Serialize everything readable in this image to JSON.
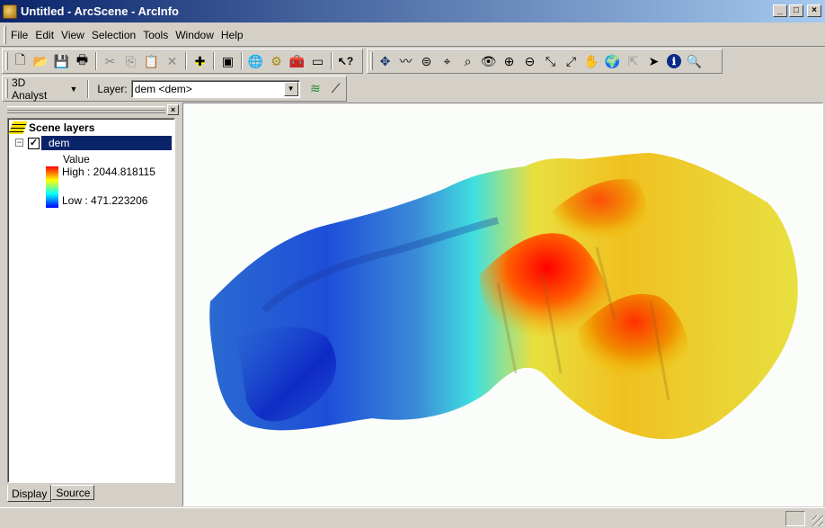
{
  "window": {
    "title": "Untitled - ArcScene - ArcInfo",
    "buttons": {
      "minimize": "_",
      "maximize": "□",
      "close": "×"
    }
  },
  "menubar": {
    "items": [
      {
        "label": "File",
        "mnemonic": "F"
      },
      {
        "label": "Edit",
        "mnemonic": "E"
      },
      {
        "label": "View",
        "mnemonic": "V"
      },
      {
        "label": "Selection",
        "mnemonic": "S"
      },
      {
        "label": "Tools",
        "mnemonic": "T"
      },
      {
        "label": "Window",
        "mnemonic": "W"
      },
      {
        "label": "Help",
        "mnemonic": "H"
      }
    ]
  },
  "standard_toolbar": {
    "icons": [
      "new-icon",
      "open-icon",
      "save-icon",
      "print-icon",
      "cut-icon",
      "copy-icon",
      "paste-icon",
      "delete-icon",
      "add-data-icon",
      "arctoolbox-window-icon",
      "arccatalog-icon",
      "model-builder-icon",
      "toolbox-icon",
      "command-line-icon",
      "whats-this-icon"
    ],
    "glyphs": [
      "🗋",
      "📂",
      "💾",
      "🖶",
      "✂",
      "⎘",
      "📋",
      "✕",
      "✚",
      "▣",
      "🌐",
      "⚙",
      "🧰",
      "▭",
      "↖?"
    ]
  },
  "tools_toolbar": {
    "icons": [
      "navigate-icon",
      "fly-icon",
      "target-zoom-icon",
      "center-on-target-icon",
      "zoom-to-target-icon",
      "set-observer-icon",
      "zoom-in-icon",
      "zoom-out-icon",
      "full-extent-icon",
      "zoom-to-layer-icon",
      "pan-icon",
      "globe-icon",
      "narrow-fov-icon",
      "select-features-icon",
      "identify-icon",
      "find-icon"
    ],
    "glyphs": [
      "✥",
      "〰",
      "⊜",
      "⌖",
      "⌕",
      "👁",
      "⊕",
      "⊖",
      "⤡",
      "⤢",
      "✋",
      "🌍",
      "⇱",
      "➤",
      "ℹ",
      "🔍"
    ]
  },
  "analyst_toolbar": {
    "menu_label": "3D Analyst",
    "menu_mnemonic": "3",
    "layer_label": "Layer:",
    "layer_value": "dem <dem>",
    "tools": [
      {
        "name": "contour-icon",
        "glyph": "≋"
      },
      {
        "name": "interpolate-line-icon",
        "glyph": "⟋"
      }
    ]
  },
  "toc": {
    "title": "Scene layers",
    "layer": {
      "name": "dem",
      "checked": true,
      "expanded": true,
      "selected": true
    },
    "legend": {
      "field": "Value",
      "high": "High : 2044.818115",
      "low": "Low : 471.223206",
      "ramp_colors": [
        "#ff0000",
        "#ff8000",
        "#ffff00",
        "#80ff80",
        "#00ffff",
        "#0080ff",
        "#0000ff"
      ]
    },
    "tabs": [
      {
        "label": "Display",
        "active": true
      },
      {
        "label": "Source",
        "active": false
      }
    ]
  },
  "scene": {
    "background": "#fbfdfa",
    "content": "3D DEM surface rendered with elevation color ramp",
    "colors": {
      "high": "#ff0000",
      "mid_high": "#f0c000",
      "mid": "#e8e840",
      "mid_low": "#30e0e0",
      "low": "#2060d0",
      "lowest": "#0a20c0"
    }
  },
  "statusbar": {
    "text": ""
  }
}
